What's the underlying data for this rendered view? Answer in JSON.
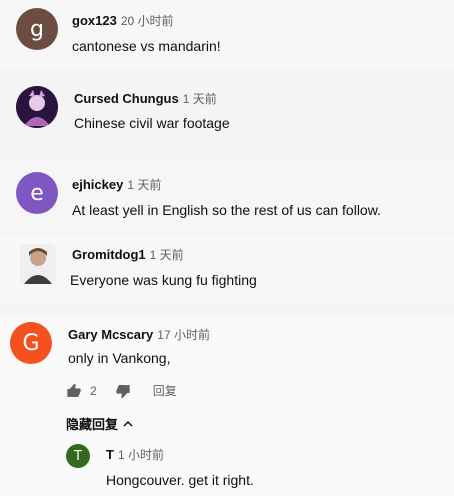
{
  "comments": [
    {
      "author": "gox123",
      "time": "20 小时前",
      "text": "cantonese  vs mandarin!",
      "avatar_letter": "g",
      "avatar_color": "#6d4c41"
    },
    {
      "author": "Cursed Chungus",
      "time": "1 天前",
      "text": "Chinese civil war footage",
      "avatar_color": "#3a1c5a"
    },
    {
      "author": "ejhickey",
      "time": "1 天前",
      "text": "At least yell in English so the rest of us can follow.",
      "avatar_letter": "e",
      "avatar_color": "#7e57c2"
    },
    {
      "author": "Gromitdog1",
      "time": "1 天前",
      "text": "Everyone was kung fu fighting",
      "avatar_color": "#d9d9d9"
    },
    {
      "author": "Gary Mcscary",
      "time": "17 小时前",
      "text": "only in Vankong,",
      "avatar_letter": "G",
      "avatar_color": "#f4511e",
      "like_count": "2",
      "reply_label": "回复",
      "hide_replies_label": "隐藏回复"
    }
  ],
  "reply": {
    "author": "T",
    "time": "1 小时前",
    "text": "Hongcouver. get it right.",
    "avatar_letter": "T",
    "avatar_color": "#33691e"
  },
  "icons": {
    "like": "thumbs-up-icon",
    "dislike": "thumbs-down-icon",
    "chevron": "chevron-up-icon"
  }
}
